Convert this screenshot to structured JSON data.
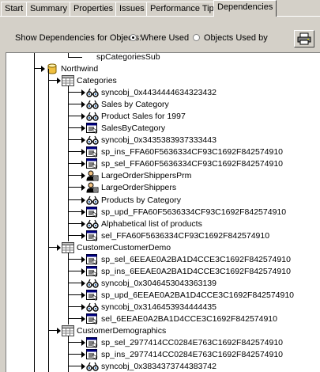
{
  "tabs": [
    "Start",
    "Summary",
    "Properties",
    "Issues",
    "Performance Tips",
    "Dependencies"
  ],
  "active_tab": "Dependencies",
  "options": {
    "label": "Show Dependencies for Objects:",
    "where_used": "Where Used",
    "objects_used_by": "Objects Used by",
    "selected": "Where Used"
  },
  "tree": {
    "top_partial": "spCategoriesSub",
    "database": "Northwind",
    "groups": [
      {
        "name": "Categories",
        "items": [
          {
            "label": "syncobj_0x4434444634323432",
            "icon": "view-icon"
          },
          {
            "label": "Sales by Category",
            "icon": "view-icon"
          },
          {
            "label": "Product Sales for 1997",
            "icon": "view-icon"
          },
          {
            "label": "SalesByCategory",
            "icon": "proc-icon"
          },
          {
            "label": "syncobj_0x3435383937333443",
            "icon": "view-icon"
          },
          {
            "label": "sp_ins_FFA60F5636334CF93C1692F842574910",
            "icon": "proc-icon"
          },
          {
            "label": "sp_sel_FFA60F5636334CF93C1692F842574910",
            "icon": "proc-icon"
          },
          {
            "label": "LargeOrderShippersPrm",
            "icon": "user-icon"
          },
          {
            "label": "LargeOrderShippers",
            "icon": "user-icon"
          },
          {
            "label": "Products by Category",
            "icon": "view-icon"
          },
          {
            "label": "sp_upd_FFA60F5636334CF93C1692F842574910",
            "icon": "proc-icon"
          },
          {
            "label": "Alphabetical list of products",
            "icon": "view-icon"
          },
          {
            "label": "sel_FFA60F5636334CF93C1692F842574910",
            "icon": "proc-icon"
          }
        ]
      },
      {
        "name": "CustomerCustomerDemo",
        "items": [
          {
            "label": "sp_sel_6EEAE0A2BA1D4CCE3C1692F842574910",
            "icon": "proc-icon"
          },
          {
            "label": "sp_ins_6EEAE0A2BA1D4CCE3C1692F842574910",
            "icon": "proc-icon"
          },
          {
            "label": "syncobj_0x3046453043363139",
            "icon": "view-icon"
          },
          {
            "label": "sp_upd_6EEAE0A2BA1D4CCE3C1692F842574910",
            "icon": "proc-icon"
          },
          {
            "label": "syncobj_0x3146453934444435",
            "icon": "view-icon"
          },
          {
            "label": "sel_6EEAE0A2BA1D4CCE3C1692F842574910",
            "icon": "proc-icon"
          }
        ]
      },
      {
        "name": "CustomerDemographics",
        "items": [
          {
            "label": "sp_sel_2977414CC0284E763C1692F842574910",
            "icon": "proc-icon"
          },
          {
            "label": "sp_ins_2977414CC0284E763C1692F842574910",
            "icon": "proc-icon"
          },
          {
            "label": "syncobj_0x3834373744383742",
            "icon": "view-icon"
          }
        ]
      }
    ]
  }
}
